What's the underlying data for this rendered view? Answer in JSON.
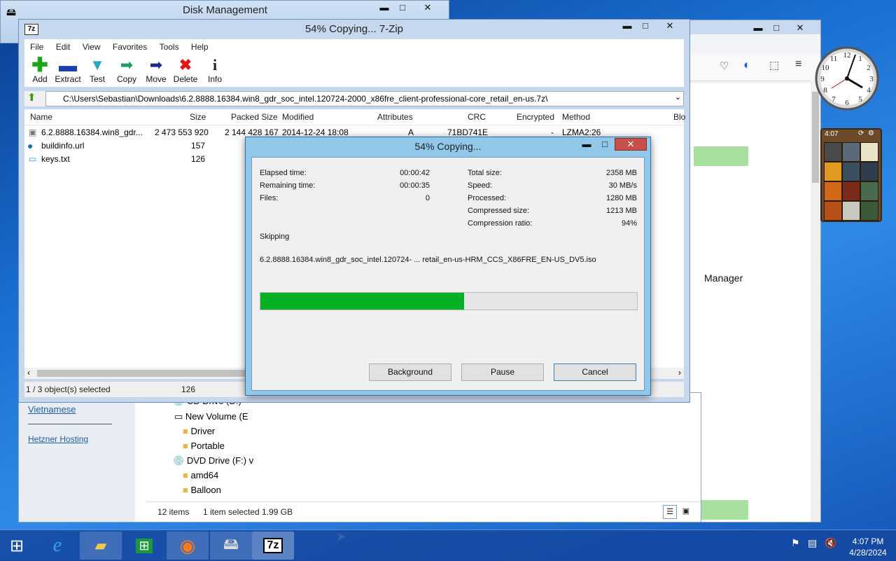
{
  "disk_management": {
    "title": "Disk Management",
    "min": "▬",
    "max": "□",
    "close": "✕"
  },
  "firefox": {
    "manager_text": "Manager"
  },
  "gadget": {
    "puzzle_time": "4:07"
  },
  "explorer": {
    "links": [
      "Vietnamese",
      "Hetzner Hosting"
    ],
    "tree": [
      "CD Drive (D:)",
      "New Volume (E",
      "Driver",
      "Portable",
      "DVD Drive (F:) v",
      "amd64",
      "Balloon"
    ],
    "status_items": "12 items",
    "status_selected": "1 item selected  1.99 GB"
  },
  "zip": {
    "title": "54% Copying... 7-Zip",
    "menu": [
      "File",
      "Edit",
      "View",
      "Favorites",
      "Tools",
      "Help"
    ],
    "toolbar": [
      {
        "label": "Add",
        "icon": "add-icon"
      },
      {
        "label": "Extract",
        "icon": "extract-icon"
      },
      {
        "label": "Test",
        "icon": "test-icon"
      },
      {
        "label": "Copy",
        "icon": "copy-icon"
      },
      {
        "label": "Move",
        "icon": "move-icon"
      },
      {
        "label": "Delete",
        "icon": "delete-icon"
      },
      {
        "label": "Info",
        "icon": "info-icon"
      }
    ],
    "path": "C:\\Users\\Sebastian\\Downloads\\6.2.8888.16384.win8_gdr_soc_intel.120724-2000_x86fre_client-professional-core_retail_en-us.7z\\",
    "columns": [
      "Name",
      "Size",
      "Packed Size",
      "Modified",
      "Attributes",
      "CRC",
      "Encrypted",
      "Method",
      "Blo"
    ],
    "rows": [
      {
        "name": "6.2.8888.16384.win8_gdr...",
        "size": "2 473 553 920",
        "packed": "2 144 428 167",
        "modified": "2014-12-24 18:08",
        "attr": "A",
        "crc": "71BD741E",
        "enc": "-",
        "method": "LZMA2:26"
      },
      {
        "name": "buildinfo.url",
        "size": "157"
      },
      {
        "name": "keys.txt",
        "size": "126"
      }
    ],
    "status_selected": "1 / 3 object(s) selected",
    "status_size": "126"
  },
  "dialog": {
    "title": "54% Copying...",
    "elapsed_label": "Elapsed time:",
    "elapsed": "00:00:42",
    "remaining_label": "Remaining time:",
    "remaining": "00:00:35",
    "files_label": "Files:",
    "files": "0",
    "total_label": "Total size:",
    "total": "2358 MB",
    "speed_label": "Speed:",
    "speed": "30 MB/s",
    "processed_label": "Processed:",
    "processed": "1280 MB",
    "compressed_label": "Compressed size:",
    "compressed": "1213 MB",
    "ratio_label": "Compression ratio:",
    "ratio": "94%",
    "action": "Skipping",
    "current_file": "6.2.8888.16384.win8_gdr_soc_intel.120724- ... retail_en-us-HRM_CCS_X86FRE_EN-US_DV5.iso",
    "progress_percent": 54,
    "btn_background": "Background",
    "btn_pause": "Pause",
    "btn_cancel": "Cancel"
  },
  "taskbar": {
    "time": "4:07 PM",
    "date": "4/28/2024"
  },
  "colors": {
    "progress": "#06b025",
    "taskbar": "#1446a0"
  }
}
